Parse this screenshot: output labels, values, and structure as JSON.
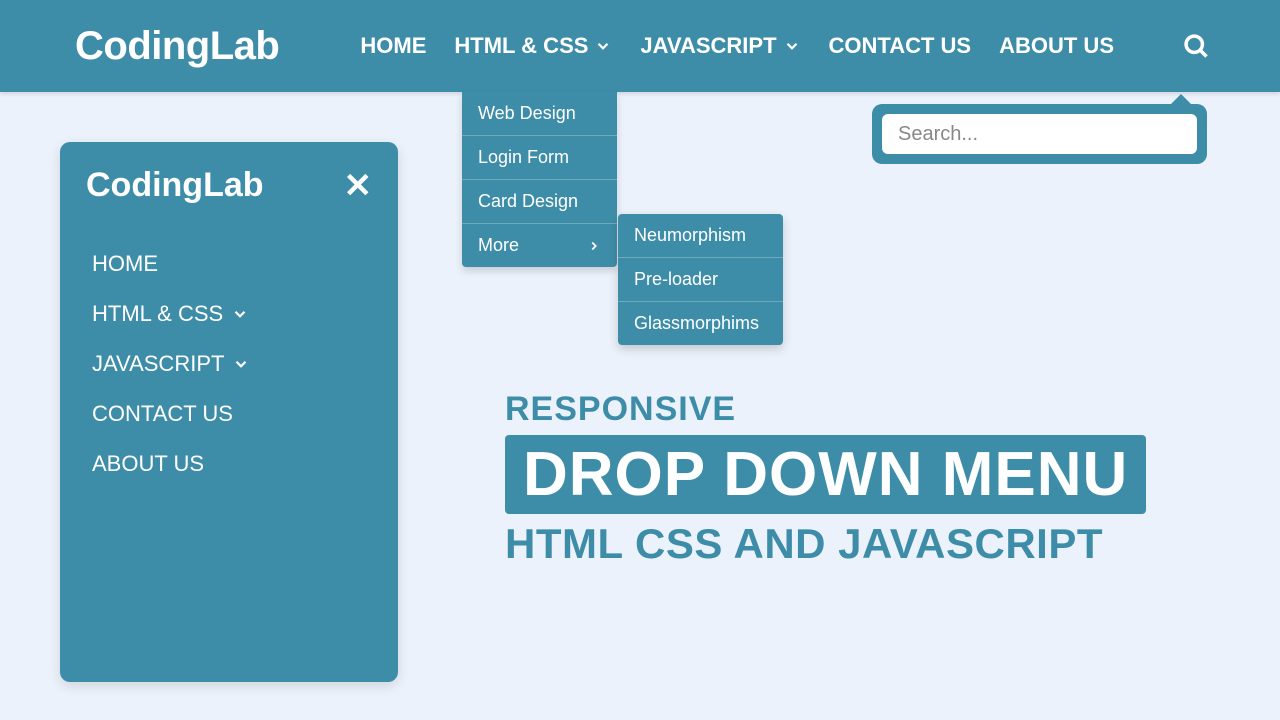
{
  "brand": "CodingLab",
  "nav": {
    "home": "HOME",
    "htmlcss": "HTML & CSS",
    "javascript": "JAVASCRIPT",
    "contact": "CONTACT US",
    "about": "ABOUT US"
  },
  "dropdown": {
    "web_design": "Web Design",
    "login_form": "Login Form",
    "card_design": "Card Design",
    "more": "More"
  },
  "submenu": {
    "neumorphism": "Neumorphism",
    "preloader": "Pre-loader",
    "glassmorphism": "Glassmorphims"
  },
  "search": {
    "placeholder": "Search..."
  },
  "sidebar": {
    "logo": "CodingLab",
    "items": {
      "home": "HOME",
      "htmlcss": "HTML & CSS",
      "javascript": "JAVASCRIPT",
      "contact": "CONTACT US",
      "about": "ABOUT US"
    }
  },
  "hero": {
    "line1": "RESPONSIVE",
    "line2": "DROP DOWN MENU",
    "line3": "HTML CSS AND JAVASCRIPT"
  }
}
